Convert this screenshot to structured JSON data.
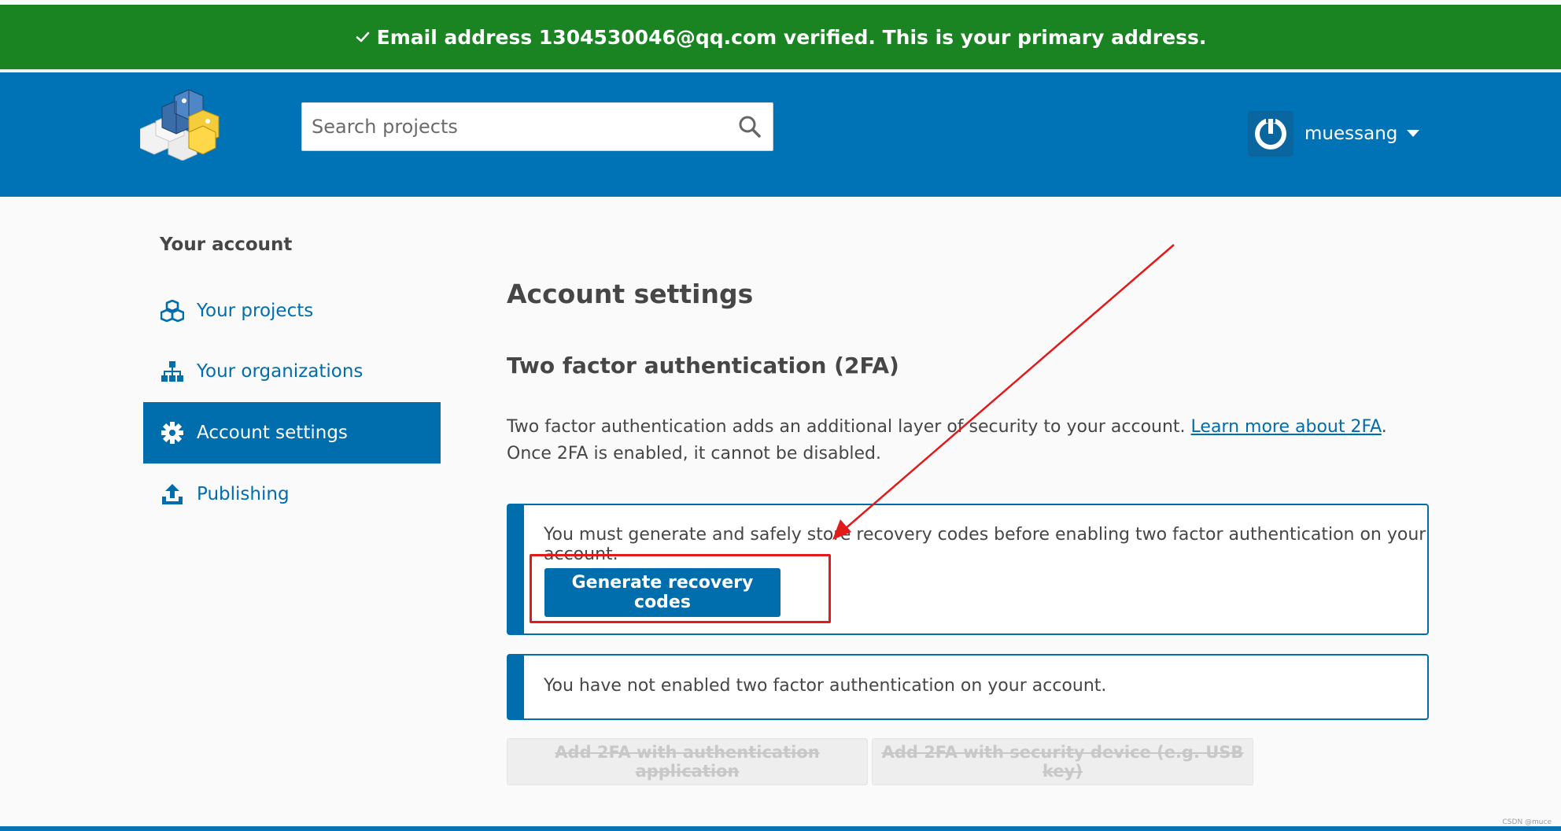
{
  "flash": {
    "message": "Email address 1304530046@qq.com verified. This is your primary address.",
    "icon": "check-icon",
    "color": "#1a8423"
  },
  "header": {
    "logo": "pypi-logo",
    "search_placeholder": "Search projects",
    "search_icon": "search-icon",
    "username": "muessang",
    "color": "#0073b7"
  },
  "sidebar": {
    "heading": "Your account",
    "items": [
      {
        "label": "Your projects",
        "icon": "cubes-icon",
        "active": false
      },
      {
        "label": "Your organizations",
        "icon": "sitemap-icon",
        "active": false
      },
      {
        "label": "Account settings",
        "icon": "gear-icon",
        "active": true
      },
      {
        "label": "Publishing",
        "icon": "upload-icon",
        "active": false
      }
    ]
  },
  "main": {
    "title": "Account settings",
    "section_title": "Two factor authentication (2FA)",
    "intro_before": "Two factor authentication adds an additional layer of security to your account. ",
    "intro_link_prefix": "Learn more about ",
    "intro_link_abbr": "2FA",
    "intro_after": ". Once 2FA is enabled, it cannot be disabled.",
    "recovery_callout": {
      "text": "You must generate and safely store recovery codes before enabling two factor authentication on your account.",
      "button": "Generate recovery codes"
    },
    "status_callout": {
      "text": "You have not enabled two factor authentication on your account."
    },
    "disabled_buttons": [
      "Add 2FA with authentication application",
      "Add 2FA with security device (e.g. USB key)"
    ]
  },
  "annotation_color": "#e21a1a",
  "watermark": "CSDN @muce"
}
